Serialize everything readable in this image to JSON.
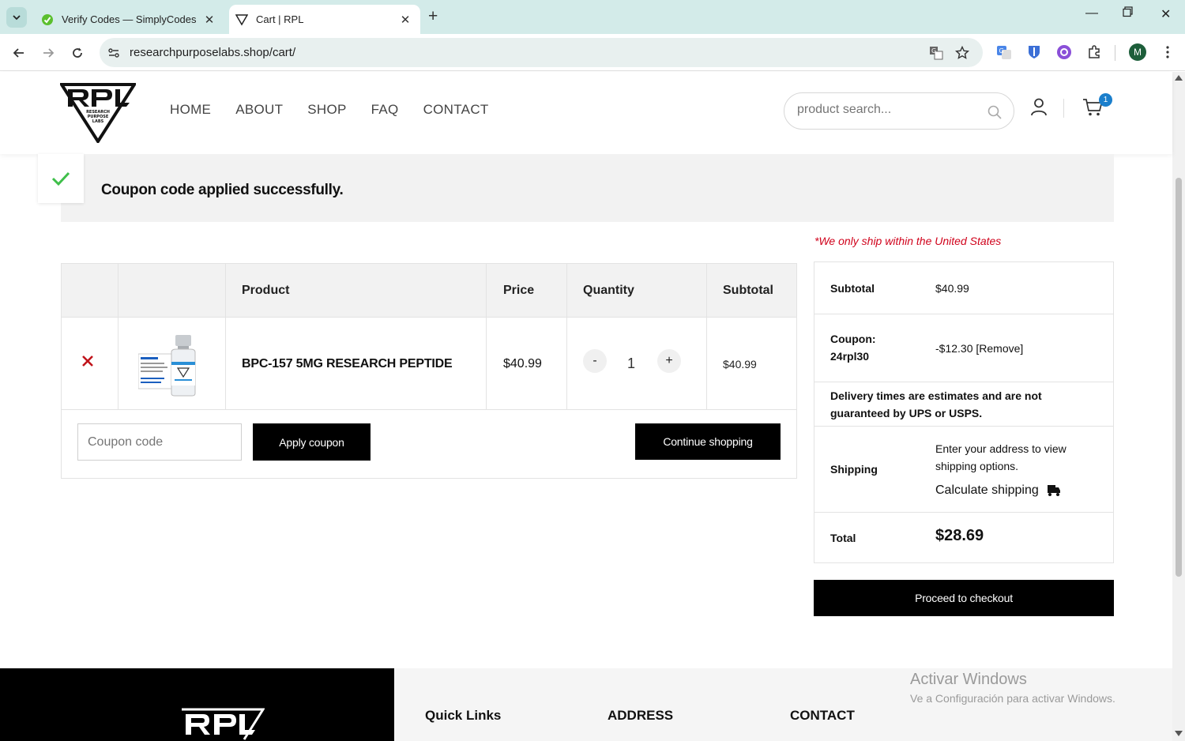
{
  "browser": {
    "tabs": [
      {
        "title": "Verify Codes — SimplyCodes",
        "active": false
      },
      {
        "title": "Cart | RPL",
        "active": true
      }
    ],
    "url": "researchpurposelabs.shop/cart/",
    "profile_initial": "M"
  },
  "header": {
    "nav": [
      "HOME",
      "ABOUT",
      "SHOP",
      "FAQ",
      "CONTACT"
    ],
    "search_placeholder": "product search...",
    "cart_count": "1"
  },
  "notice": {
    "message": "Coupon code applied successfully."
  },
  "shipping_note": "*We only ship within the United States",
  "cart": {
    "columns": {
      "product": "Product",
      "price": "Price",
      "quantity": "Quantity",
      "subtotal": "Subtotal"
    },
    "item": {
      "name": "BPC-157 5MG RESEARCH PEPTIDE",
      "price": "$40.99",
      "quantity": "1",
      "subtotal": "$40.99",
      "decrease": "-",
      "increase": "+",
      "remove": "×"
    },
    "coupon_placeholder": "Coupon code",
    "apply_label": "Apply coupon",
    "continue_label": "Continue shopping"
  },
  "totals": {
    "subtotal_label": "Subtotal",
    "subtotal_value": "$40.99",
    "coupon_label": "Coupon: 24rpl30",
    "coupon_value": "-$12.30",
    "coupon_remove": "[Remove]",
    "delivery_note": "Delivery times are estimates and are not guaranteed by UPS or USPS.",
    "shipping_label": "Shipping",
    "shipping_text": "Enter your address to view shipping options.",
    "calculate_label": "Calculate shipping",
    "total_label": "Total",
    "total_value": "$28.69",
    "checkout_label": "Proceed to checkout"
  },
  "footer": {
    "quick_links": "Quick Links",
    "address": "ADDRESS",
    "contact": "CONTACT"
  },
  "watermark": {
    "line1": "Activar Windows",
    "line2": "Ve a Configuración para activar Windows."
  },
  "colors": {
    "accent_blue": "#1b7fcc",
    "warning_red": "#d0021b",
    "check_green": "#3fbf4a",
    "remove_red": "#c0141b"
  }
}
